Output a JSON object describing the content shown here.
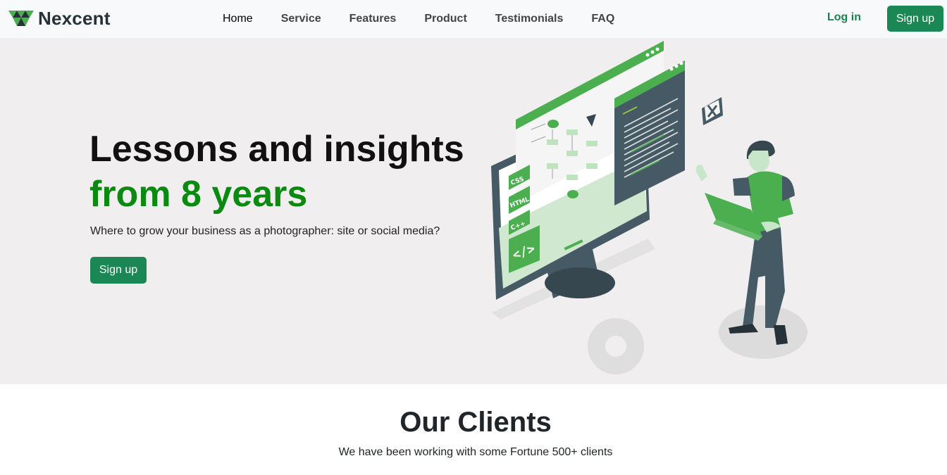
{
  "brand": {
    "name": "Nexcent",
    "color": "#263238",
    "accent": "#4caf4f"
  },
  "nav": {
    "items": [
      {
        "label": "Home",
        "active": true
      },
      {
        "label": "Service",
        "active": false
      },
      {
        "label": "Features",
        "active": false
      },
      {
        "label": "Product",
        "active": false
      },
      {
        "label": "Testimonials",
        "active": false
      },
      {
        "label": "FAQ",
        "active": false
      }
    ],
    "login_label": "Log in",
    "signup_label": "Sign up"
  },
  "hero": {
    "headline_line1": "Lessons and insights",
    "headline_line2": "from 8 years",
    "subtext": "Where to grow your business as a photographer: site or social media?",
    "cta_label": "Sign up",
    "illustration": {
      "code_tags": [
        "CSS",
        "HTML",
        "C++"
      ],
      "icon": "developer-illustration"
    }
  },
  "clients": {
    "title": "Our Clients",
    "subtitle": "We have been working with some Fortune 500+ clients"
  },
  "colors": {
    "primary_button": "#1a8754",
    "headline_green": "#0a8a10",
    "hero_bg": "#f0eeef",
    "nav_bg": "#f8f9fa"
  }
}
